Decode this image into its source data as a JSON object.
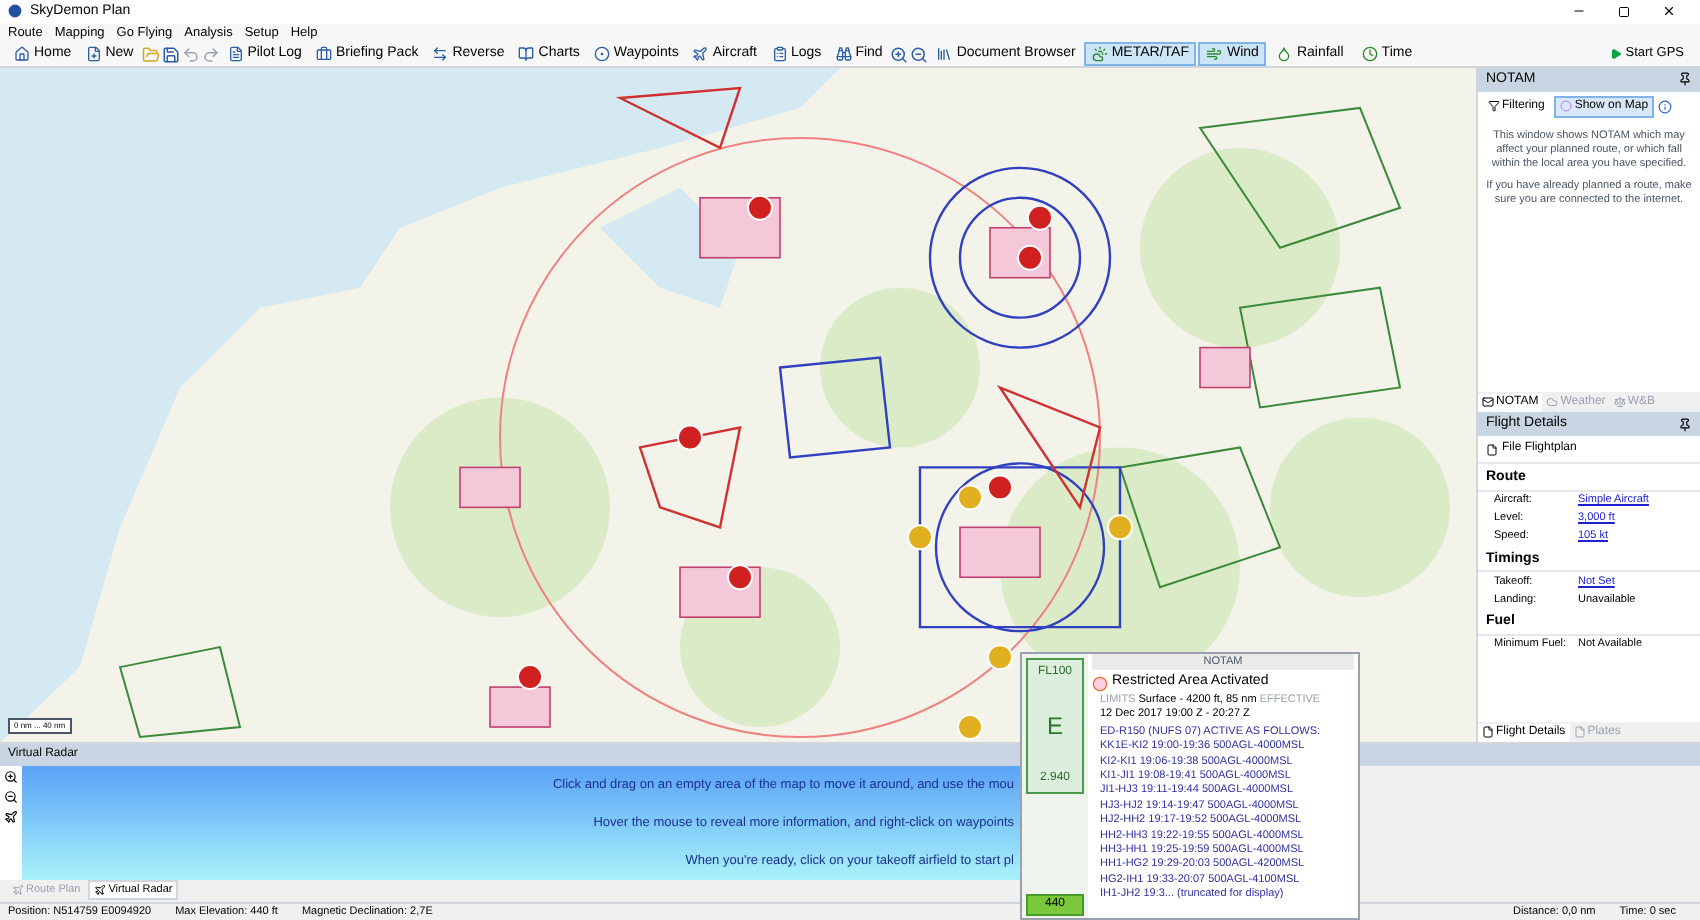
{
  "window": {
    "title": "SkyDemon Plan"
  },
  "menu": [
    "Route",
    "Mapping",
    "Go Flying",
    "Analysis",
    "Setup",
    "Help"
  ],
  "toolbar": [
    {
      "kind": "button",
      "label": "Home"
    },
    {
      "kind": "button",
      "label": "New"
    },
    {
      "kind": "files"
    },
    {
      "kind": "history"
    },
    {
      "kind": "button",
      "label": "Pilot Log"
    },
    {
      "kind": "button",
      "label": "Briefing Pack"
    },
    {
      "kind": "button",
      "label": "Reverse"
    },
    {
      "kind": "button",
      "label": "Charts"
    },
    {
      "kind": "button",
      "label": "Waypoints"
    },
    {
      "kind": "button",
      "label": "Aircraft"
    },
    {
      "kind": "button",
      "label": "Logs"
    },
    {
      "kind": "button",
      "label": "Find"
    },
    {
      "kind": "zoom"
    },
    {
      "kind": "button",
      "label": "Document Browser"
    },
    {
      "kind": "toggle",
      "label": "METAR/TAF",
      "selected": true
    },
    {
      "kind": "toggle",
      "label": "Wind",
      "selected": true
    },
    {
      "kind": "toggle",
      "label": "Rainfall",
      "selected": false
    },
    {
      "kind": "toggle",
      "label": "Time",
      "selected": false
    }
  ],
  "start_gps": "Start GPS",
  "map": {
    "scale": "0 nm ... 40 nm"
  },
  "notam_panel": {
    "title": "NOTAM",
    "filter_tabs": [
      {
        "label": "Filtering",
        "selected": false
      },
      {
        "label": "Show on Map",
        "selected": true
      }
    ],
    "paragraphs": [
      "This window shows NOTAM which may affect your planned route, or which fall within the local area you have specified.",
      "If you have already planned a route, make sure you are connected to the internet."
    ],
    "tabs": [
      {
        "label": "NOTAM",
        "selected": true
      },
      {
        "label": "Weather",
        "selected": false
      },
      {
        "label": "W&B",
        "selected": false
      }
    ]
  },
  "flight_details": {
    "title": "Flight Details",
    "file_button": "File Flightplan",
    "sections": [
      {
        "heading": "Route",
        "rows": [
          {
            "label": "Aircraft:",
            "value": "Simple Aircraft",
            "kind": "link"
          },
          {
            "label": "Level:",
            "value": "3,000 ft",
            "kind": "link"
          },
          {
            "label": "Speed:",
            "value": "105 kt",
            "kind": "link"
          }
        ]
      },
      {
        "heading": "Timings",
        "rows": [
          {
            "label": "Takeoff:",
            "value": "Not Set",
            "kind": "link"
          },
          {
            "label": "Landing:",
            "value": "Unavailable",
            "kind": "text"
          }
        ]
      },
      {
        "heading": "Fuel",
        "rows": [
          {
            "label": "Minimum Fuel:",
            "value": "Not Available",
            "kind": "text"
          }
        ]
      }
    ],
    "tabs": [
      {
        "label": "Flight Details",
        "selected": true
      },
      {
        "label": "Plates",
        "selected": false
      }
    ]
  },
  "virtual_radar": {
    "title": "Virtual Radar",
    "lines": [
      "Click and drag on an empty area of the map to move it around, and use the mou",
      "Hover the mouse to reveal more information, and right-click on waypoints",
      "When you're ready, click on your takeoff airfield to start pl"
    ]
  },
  "bottom_tabs": [
    {
      "label": "Route Plan",
      "selected": false
    },
    {
      "label": "Virtual Radar",
      "selected": true
    }
  ],
  "popup": {
    "top_level": "FL100",
    "airspace_class": "E",
    "bottom_level": "2.940",
    "elevation": "440",
    "header": "NOTAM",
    "title": "Restricted Area Activated",
    "limits_label": "LIMITS",
    "limits": "Surface - 4200 ft, 85 nm",
    "effective_label": "EFFECTIVE",
    "period": "12 Dec 2017 19:00 Z - 20:27 Z",
    "body": [
      "ED-R150 (NUFS 07) ACTIVE AS FOLLOWS:",
      "KK1E-KI2 19:00-19:36 500AGL-4000MSL",
      "KI2-KI1 19:06-19:38 500AGL-4000MSL",
      "KI1-JI1 19:08-19:41 500AGL-4000MSL",
      "JI1-HJ3 19:11-19:44 500AGL-4000MSL",
      "HJ3-HJ2 19:14-19:47 500AGL-4000MSL",
      "HJ2-HH2 19:17-19:52 500AGL-4000MSL",
      "HH2-HH3 19:22-19:55 500AGL-4000MSL",
      "HH3-HH1 19:25-19:59 500AGL-4000MSL",
      "HH1-HG2 19:29-20:03 500AGL-4200MSL",
      "HG2-IH1 19:33-20:07 500AGL-4100MSL",
      "IH1-JH2 19:3... (truncated for display)"
    ]
  },
  "status_bar": {
    "position": "Position: N514759 E0094920",
    "max_elevation": "Max Elevation: 440 ft",
    "declination": "Magnetic Declination: 2,7E",
    "distance": "Distance: 0,0 nm",
    "time": "Time: 0 sec"
  }
}
